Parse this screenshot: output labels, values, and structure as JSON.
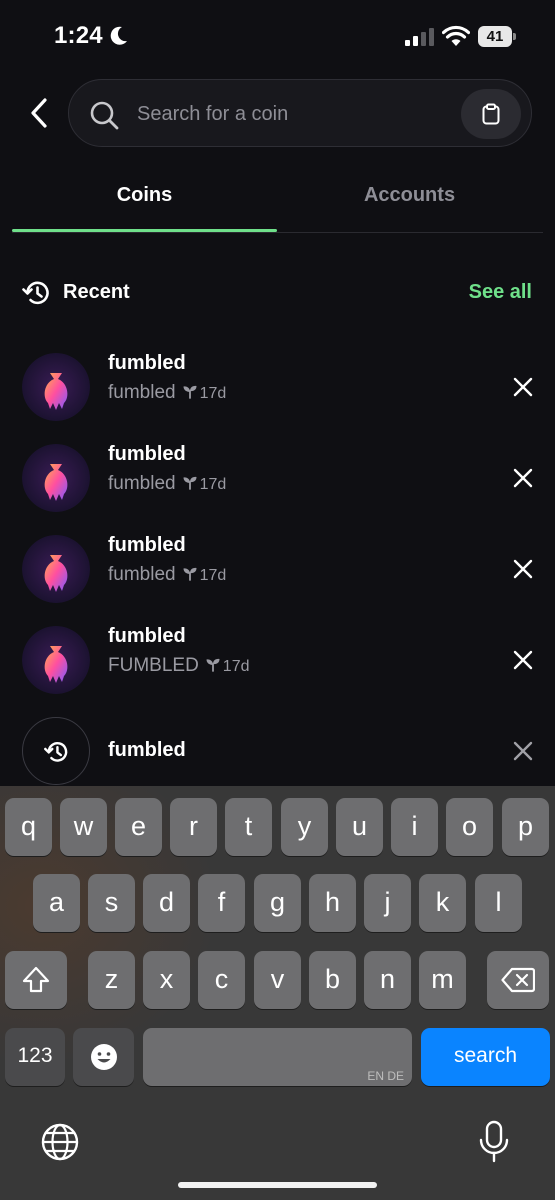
{
  "status_bar": {
    "time": "1:24",
    "battery": "41"
  },
  "search": {
    "placeholder": "Search for a coin"
  },
  "tabs": [
    {
      "label": "Coins",
      "selected": true
    },
    {
      "label": "Accounts",
      "selected": false
    }
  ],
  "recent": {
    "title": "Recent",
    "see_all": "See all"
  },
  "recent_items": [
    {
      "name": "fumbled",
      "ticker": "fumbled",
      "age": "17d"
    },
    {
      "name": "fumbled",
      "ticker": "fumbled",
      "age": "17d"
    },
    {
      "name": "fumbled",
      "ticker": "fumbled",
      "age": "17d"
    },
    {
      "name": "fumbled",
      "ticker": "FUMBLED",
      "age": "17d"
    }
  ],
  "recent_search": {
    "query": "fumbled"
  },
  "keyboard": {
    "row1": [
      "q",
      "w",
      "e",
      "r",
      "t",
      "y",
      "u",
      "i",
      "o",
      "p"
    ],
    "row2": [
      "a",
      "s",
      "d",
      "f",
      "g",
      "h",
      "j",
      "k",
      "l"
    ],
    "row3": [
      "z",
      "x",
      "c",
      "v",
      "b",
      "n",
      "m"
    ],
    "numbers_key": "123",
    "space_lang": "EN DE",
    "search_key": "search"
  },
  "colors": {
    "accent": "#6fe08a",
    "keyboard_action": "#0a84ff"
  }
}
